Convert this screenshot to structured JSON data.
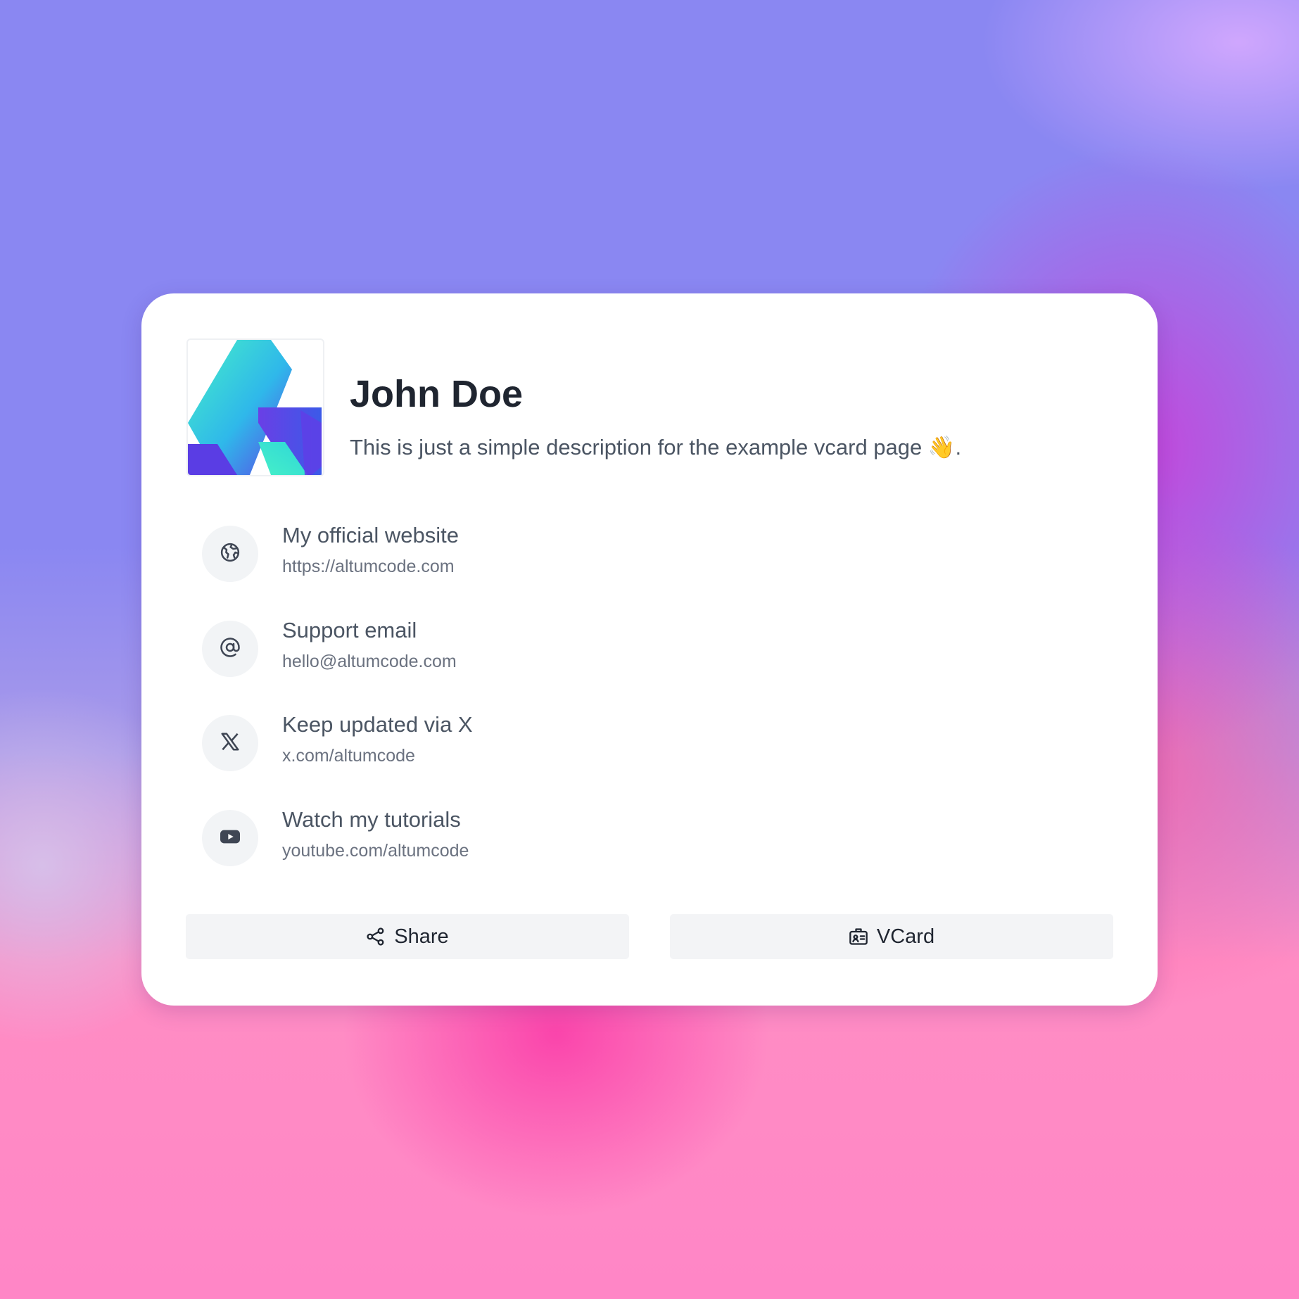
{
  "profile": {
    "logo": "altumcode-logo",
    "name": "John Doe",
    "description": "This is just a simple description for the example vcard page 👋."
  },
  "links": [
    {
      "icon": "globe-icon",
      "title": "My official website",
      "subtitle": "https://altumcode.com"
    },
    {
      "icon": "at-sign-icon",
      "title": "Support email",
      "subtitle": "hello@altumcode.com"
    },
    {
      "icon": "x-logo-icon",
      "title": "Keep updated via X",
      "subtitle": "x.com/altumcode"
    },
    {
      "icon": "youtube-icon",
      "title": "Watch my tutorials",
      "subtitle": "youtube.com/altumcode"
    }
  ],
  "buttons": {
    "share_label": "Share",
    "share_icon": "share-icon",
    "vcard_label": "VCard",
    "vcard_icon": "contact-card-icon"
  },
  "colors": {
    "card_background": "#ffffff",
    "heading": "#1f2530",
    "text": "#4b5563",
    "muted": "#6b7280",
    "chip": "#f2f4f6"
  }
}
